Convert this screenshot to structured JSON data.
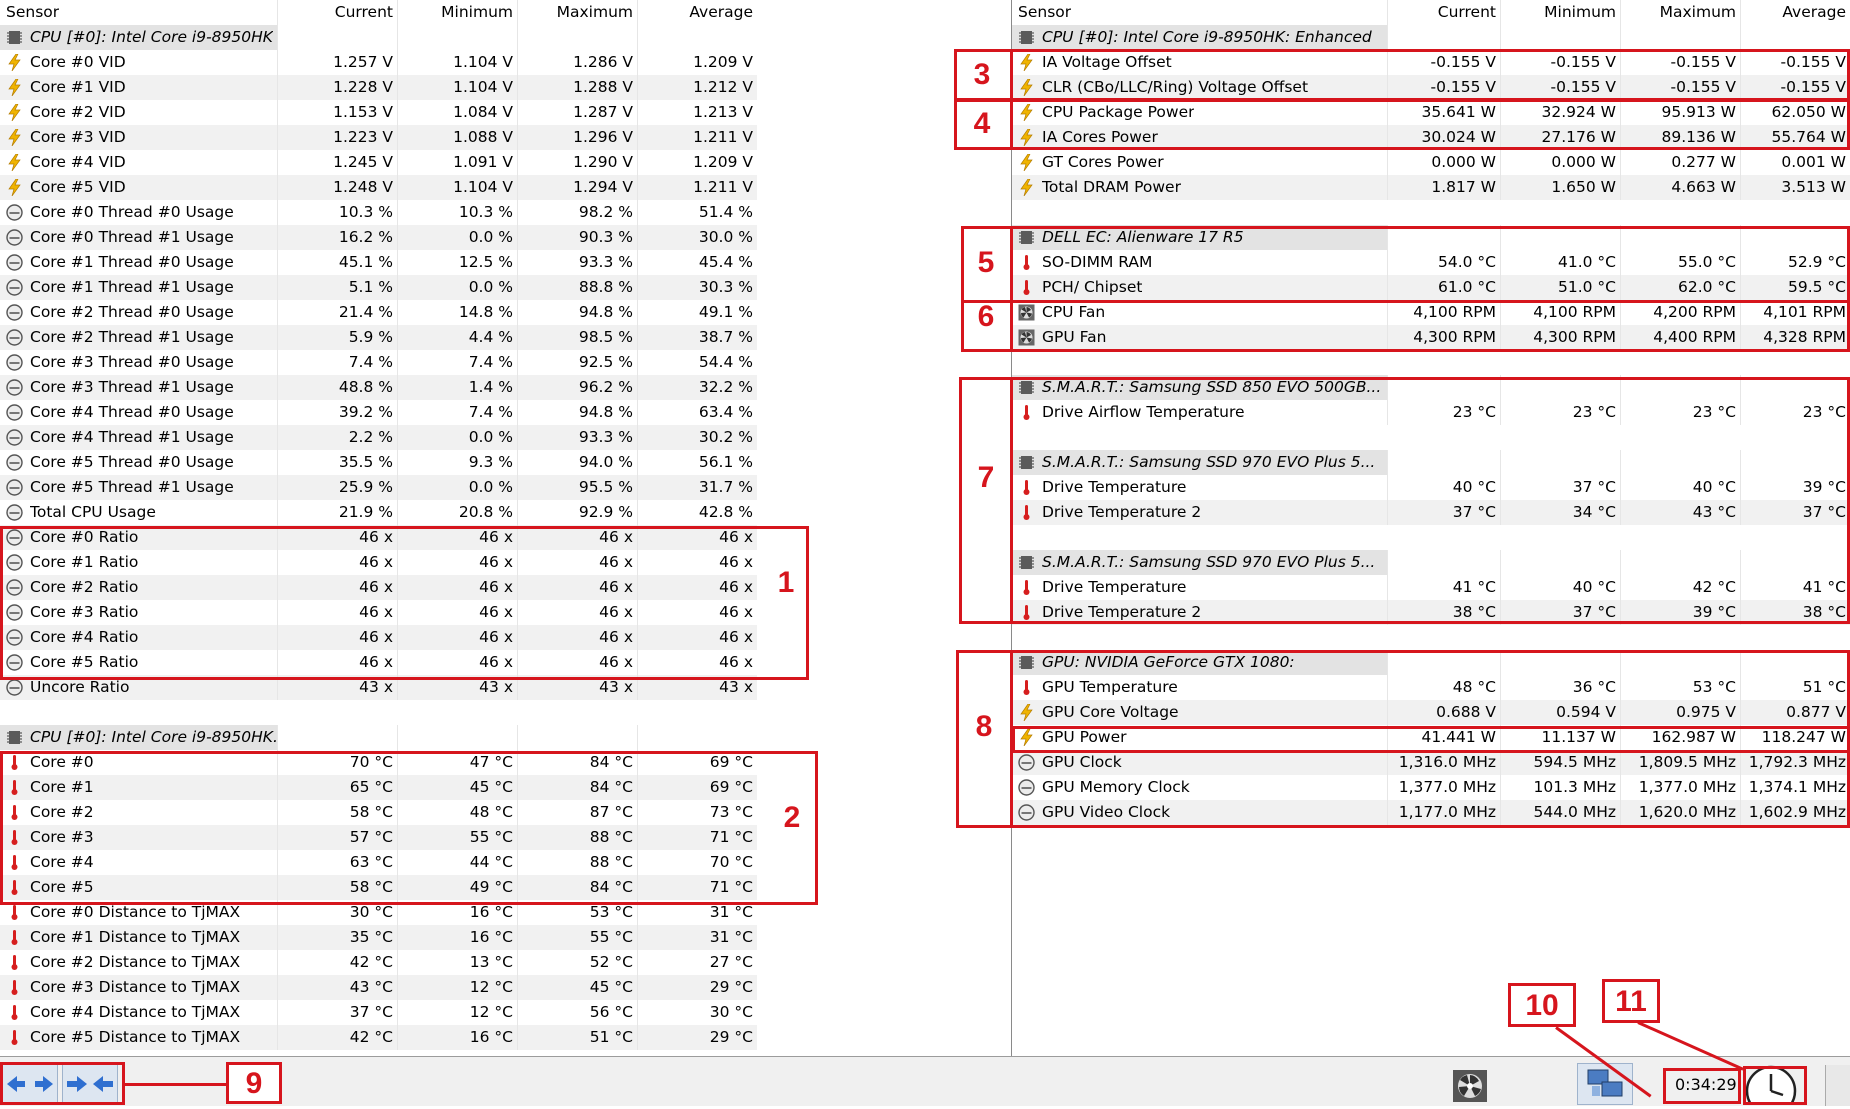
{
  "columns": [
    "Sensor",
    "Current",
    "Minimum",
    "Maximum",
    "Average"
  ],
  "left_rows": [
    {
      "kind": "group",
      "icon": "chip-icon",
      "name": "CPU [#0]: Intel Core i9-8950HK"
    },
    {
      "kind": "data",
      "icon": "voltage-icon",
      "name": "Core #0 VID",
      "v": [
        "1.257 V",
        "1.104 V",
        "1.286 V",
        "1.209 V"
      ]
    },
    {
      "kind": "data",
      "icon": "voltage-icon",
      "name": "Core #1 VID",
      "v": [
        "1.228 V",
        "1.104 V",
        "1.288 V",
        "1.212 V"
      ]
    },
    {
      "kind": "data",
      "icon": "voltage-icon",
      "name": "Core #2 VID",
      "v": [
        "1.153 V",
        "1.084 V",
        "1.287 V",
        "1.213 V"
      ]
    },
    {
      "kind": "data",
      "icon": "voltage-icon",
      "name": "Core #3 VID",
      "v": [
        "1.223 V",
        "1.088 V",
        "1.296 V",
        "1.211 V"
      ]
    },
    {
      "kind": "data",
      "icon": "voltage-icon",
      "name": "Core #4 VID",
      "v": [
        "1.245 V",
        "1.091 V",
        "1.290 V",
        "1.209 V"
      ]
    },
    {
      "kind": "data",
      "icon": "voltage-icon",
      "name": "Core #5 VID",
      "v": [
        "1.248 V",
        "1.104 V",
        "1.294 V",
        "1.211 V"
      ]
    },
    {
      "kind": "data",
      "icon": "gauge-icon",
      "name": "Core #0 Thread #0 Usage",
      "v": [
        "10.3 %",
        "10.3 %",
        "98.2 %",
        "51.4 %"
      ]
    },
    {
      "kind": "data",
      "icon": "gauge-icon",
      "name": "Core #0 Thread #1 Usage",
      "v": [
        "16.2 %",
        "0.0 %",
        "90.3 %",
        "30.0 %"
      ]
    },
    {
      "kind": "data",
      "icon": "gauge-icon",
      "name": "Core #1 Thread #0 Usage",
      "v": [
        "45.1 %",
        "12.5 %",
        "93.3 %",
        "45.4 %"
      ]
    },
    {
      "kind": "data",
      "icon": "gauge-icon",
      "name": "Core #1 Thread #1 Usage",
      "v": [
        "5.1 %",
        "0.0 %",
        "88.8 %",
        "30.3 %"
      ]
    },
    {
      "kind": "data",
      "icon": "gauge-icon",
      "name": "Core #2 Thread #0 Usage",
      "v": [
        "21.4 %",
        "14.8 %",
        "94.8 %",
        "49.1 %"
      ]
    },
    {
      "kind": "data",
      "icon": "gauge-icon",
      "name": "Core #2 Thread #1 Usage",
      "v": [
        "5.9 %",
        "4.4 %",
        "98.5 %",
        "38.7 %"
      ]
    },
    {
      "kind": "data",
      "icon": "gauge-icon",
      "name": "Core #3 Thread #0 Usage",
      "v": [
        "7.4 %",
        "7.4 %",
        "92.5 %",
        "54.4 %"
      ]
    },
    {
      "kind": "data",
      "icon": "gauge-icon",
      "name": "Core #3 Thread #1 Usage",
      "v": [
        "48.8 %",
        "1.4 %",
        "96.2 %",
        "32.2 %"
      ]
    },
    {
      "kind": "data",
      "icon": "gauge-icon",
      "name": "Core #4 Thread #0 Usage",
      "v": [
        "39.2 %",
        "7.4 %",
        "94.8 %",
        "63.4 %"
      ]
    },
    {
      "kind": "data",
      "icon": "gauge-icon",
      "name": "Core #4 Thread #1 Usage",
      "v": [
        "2.2 %",
        "0.0 %",
        "93.3 %",
        "30.2 %"
      ]
    },
    {
      "kind": "data",
      "icon": "gauge-icon",
      "name": "Core #5 Thread #0 Usage",
      "v": [
        "35.5 %",
        "9.3 %",
        "94.0 %",
        "56.1 %"
      ]
    },
    {
      "kind": "data",
      "icon": "gauge-icon",
      "name": "Core #5 Thread #1 Usage",
      "v": [
        "25.9 %",
        "0.0 %",
        "95.5 %",
        "31.7 %"
      ]
    },
    {
      "kind": "data",
      "icon": "gauge-icon",
      "name": "Total CPU Usage",
      "v": [
        "21.9 %",
        "20.8 %",
        "92.9 %",
        "42.8 %"
      ]
    },
    {
      "kind": "data",
      "icon": "gauge-icon",
      "name": "Core #0 Ratio",
      "v": [
        "46 x",
        "46 x",
        "46 x",
        "46 x"
      ]
    },
    {
      "kind": "data",
      "icon": "gauge-icon",
      "name": "Core #1 Ratio",
      "v": [
        "46 x",
        "46 x",
        "46 x",
        "46 x"
      ]
    },
    {
      "kind": "data",
      "icon": "gauge-icon",
      "name": "Core #2 Ratio",
      "v": [
        "46 x",
        "46 x",
        "46 x",
        "46 x"
      ]
    },
    {
      "kind": "data",
      "icon": "gauge-icon",
      "name": "Core #3 Ratio",
      "v": [
        "46 x",
        "46 x",
        "46 x",
        "46 x"
      ]
    },
    {
      "kind": "data",
      "icon": "gauge-icon",
      "name": "Core #4 Ratio",
      "v": [
        "46 x",
        "46 x",
        "46 x",
        "46 x"
      ]
    },
    {
      "kind": "data",
      "icon": "gauge-icon",
      "name": "Core #5 Ratio",
      "v": [
        "46 x",
        "46 x",
        "46 x",
        "46 x"
      ]
    },
    {
      "kind": "data",
      "icon": "gauge-icon",
      "name": "Uncore Ratio",
      "v": [
        "43 x",
        "43 x",
        "43 x",
        "43 x"
      ]
    },
    {
      "kind": "blank"
    },
    {
      "kind": "group",
      "icon": "chip-icon",
      "name": "CPU [#0]: Intel Core i9-8950HK..."
    },
    {
      "kind": "data",
      "icon": "thermometer-icon",
      "name": "Core #0",
      "v": [
        "70 °C",
        "47 °C",
        "84 °C",
        "69 °C"
      ]
    },
    {
      "kind": "data",
      "icon": "thermometer-icon",
      "name": "Core #1",
      "v": [
        "65 °C",
        "45 °C",
        "84 °C",
        "69 °C"
      ]
    },
    {
      "kind": "data",
      "icon": "thermometer-icon",
      "name": "Core #2",
      "v": [
        "58 °C",
        "48 °C",
        "87 °C",
        "73 °C"
      ]
    },
    {
      "kind": "data",
      "icon": "thermometer-icon",
      "name": "Core #3",
      "v": [
        "57 °C",
        "55 °C",
        "88 °C",
        "71 °C"
      ]
    },
    {
      "kind": "data",
      "icon": "thermometer-icon",
      "name": "Core #4",
      "v": [
        "63 °C",
        "44 °C",
        "88 °C",
        "70 °C"
      ]
    },
    {
      "kind": "data",
      "icon": "thermometer-icon",
      "name": "Core #5",
      "v": [
        "58 °C",
        "49 °C",
        "84 °C",
        "71 °C"
      ]
    },
    {
      "kind": "data",
      "icon": "thermometer-icon",
      "name": "Core #0 Distance to TjMAX",
      "v": [
        "30 °C",
        "16 °C",
        "53 °C",
        "31 °C"
      ]
    },
    {
      "kind": "data",
      "icon": "thermometer-icon",
      "name": "Core #1 Distance to TjMAX",
      "v": [
        "35 °C",
        "16 °C",
        "55 °C",
        "31 °C"
      ]
    },
    {
      "kind": "data",
      "icon": "thermometer-icon",
      "name": "Core #2 Distance to TjMAX",
      "v": [
        "42 °C",
        "13 °C",
        "52 °C",
        "27 °C"
      ]
    },
    {
      "kind": "data",
      "icon": "thermometer-icon",
      "name": "Core #3 Distance to TjMAX",
      "v": [
        "43 °C",
        "12 °C",
        "45 °C",
        "29 °C"
      ]
    },
    {
      "kind": "data",
      "icon": "thermometer-icon",
      "name": "Core #4 Distance to TjMAX",
      "v": [
        "37 °C",
        "12 °C",
        "56 °C",
        "30 °C"
      ]
    },
    {
      "kind": "data",
      "icon": "thermometer-icon",
      "name": "Core #5 Distance to TjMAX",
      "v": [
        "42 °C",
        "16 °C",
        "51 °C",
        "29 °C"
      ]
    }
  ],
  "right_rows": [
    {
      "kind": "group",
      "icon": "chip-icon",
      "name": "CPU [#0]: Intel Core i9-8950HK: Enhanced"
    },
    {
      "kind": "data",
      "icon": "voltage-icon",
      "name": "IA Voltage Offset",
      "v": [
        "-0.155 V",
        "-0.155 V",
        "-0.155 V",
        "-0.155 V"
      ]
    },
    {
      "kind": "data",
      "icon": "voltage-icon",
      "name": "CLR (CBo/LLC/Ring) Voltage Offset",
      "v": [
        "-0.155 V",
        "-0.155 V",
        "-0.155 V",
        "-0.155 V"
      ]
    },
    {
      "kind": "data",
      "icon": "power-icon",
      "name": "CPU Package Power",
      "v": [
        "35.641 W",
        "32.924 W",
        "95.913 W",
        "62.050 W"
      ]
    },
    {
      "kind": "data",
      "icon": "power-icon",
      "name": "IA Cores Power",
      "v": [
        "30.024 W",
        "27.176 W",
        "89.136 W",
        "55.764 W"
      ]
    },
    {
      "kind": "data",
      "icon": "power-icon",
      "name": "GT Cores Power",
      "v": [
        "0.000 W",
        "0.000 W",
        "0.277 W",
        "0.001 W"
      ]
    },
    {
      "kind": "data",
      "icon": "power-icon",
      "name": "Total DRAM Power",
      "v": [
        "1.817 W",
        "1.650 W",
        "4.663 W",
        "3.513 W"
      ]
    },
    {
      "kind": "blank"
    },
    {
      "kind": "group",
      "icon": "chip-icon",
      "name": "DELL EC: Alienware 17 R5"
    },
    {
      "kind": "data",
      "icon": "thermometer-icon",
      "name": "SO-DIMM RAM",
      "v": [
        "54.0 °C",
        "41.0 °C",
        "55.0 °C",
        "52.9 °C"
      ]
    },
    {
      "kind": "data",
      "icon": "thermometer-icon",
      "name": "PCH/ Chipset",
      "v": [
        "61.0 °C",
        "51.0 °C",
        "62.0 °C",
        "59.5 °C"
      ]
    },
    {
      "kind": "data",
      "icon": "fan-icon",
      "name": "CPU Fan",
      "v": [
        "4,100 RPM",
        "4,100 RPM",
        "4,200 RPM",
        "4,101 RPM"
      ]
    },
    {
      "kind": "data",
      "icon": "fan-icon",
      "name": "GPU Fan",
      "v": [
        "4,300 RPM",
        "4,300 RPM",
        "4,400 RPM",
        "4,328 RPM"
      ]
    },
    {
      "kind": "blank"
    },
    {
      "kind": "group",
      "icon": "chip-icon",
      "name": "S.M.A.R.T.: Samsung SSD 850 EVO 500GB..."
    },
    {
      "kind": "data",
      "icon": "thermometer-icon",
      "name": "Drive Airflow Temperature",
      "v": [
        "23 °C",
        "23 °C",
        "23 °C",
        "23 °C"
      ]
    },
    {
      "kind": "blank"
    },
    {
      "kind": "group",
      "icon": "chip-icon",
      "name": "S.M.A.R.T.: Samsung SSD 970 EVO Plus 5..."
    },
    {
      "kind": "data",
      "icon": "thermometer-icon",
      "name": "Drive Temperature",
      "v": [
        "40 °C",
        "37 °C",
        "40 °C",
        "39 °C"
      ]
    },
    {
      "kind": "data",
      "icon": "thermometer-icon",
      "name": "Drive Temperature 2",
      "v": [
        "37 °C",
        "34 °C",
        "43 °C",
        "37 °C"
      ]
    },
    {
      "kind": "blank"
    },
    {
      "kind": "group",
      "icon": "chip-icon",
      "name": "S.M.A.R.T.: Samsung SSD 970 EVO Plus 5..."
    },
    {
      "kind": "data",
      "icon": "thermometer-icon",
      "name": "Drive Temperature",
      "v": [
        "41 °C",
        "40 °C",
        "42 °C",
        "41 °C"
      ]
    },
    {
      "kind": "data",
      "icon": "thermometer-icon",
      "name": "Drive Temperature 2",
      "v": [
        "38 °C",
        "37 °C",
        "39 °C",
        "38 °C"
      ]
    },
    {
      "kind": "blank"
    },
    {
      "kind": "group",
      "icon": "chip-icon",
      "name": "GPU: NVIDIA GeForce GTX 1080:"
    },
    {
      "kind": "data",
      "icon": "thermometer-icon",
      "name": "GPU Temperature",
      "v": [
        "48 °C",
        "36 °C",
        "53 °C",
        "51 °C"
      ]
    },
    {
      "kind": "data",
      "icon": "voltage-icon",
      "name": "GPU Core Voltage",
      "v": [
        "0.688 V",
        "0.594 V",
        "0.975 V",
        "0.877 V"
      ]
    },
    {
      "kind": "data",
      "icon": "power-icon",
      "name": "GPU Power",
      "v": [
        "41.441 W",
        "11.137 W",
        "162.987 W",
        "118.247 W"
      ]
    },
    {
      "kind": "data",
      "icon": "gauge-icon",
      "name": "GPU Clock",
      "v": [
        "1,316.0 MHz",
        "594.5 MHz",
        "1,809.5 MHz",
        "1,792.3 MHz"
      ]
    },
    {
      "kind": "data",
      "icon": "gauge-icon",
      "name": "GPU Memory Clock",
      "v": [
        "1,377.0 MHz",
        "101.3 MHz",
        "1,377.0 MHz",
        "1,374.1 MHz"
      ]
    },
    {
      "kind": "data",
      "icon": "gauge-icon",
      "name": "GPU Video Clock",
      "v": [
        "1,177.0 MHz",
        "544.0 MHz",
        "1,620.0 MHz",
        "1,602.9 MHz"
      ]
    }
  ],
  "annotations": [
    "1",
    "2",
    "3",
    "4",
    "5",
    "6",
    "7",
    "8",
    "9",
    "10",
    "11"
  ],
  "statusbar": {
    "timer": "0:34:29",
    "icons": [
      "expand-icon",
      "collapse-icon",
      "fan-settings-icon",
      "network-icon",
      "clock-icon"
    ]
  },
  "colors": {
    "annotation": "#d6151d",
    "group_bg": "#e3e3e3",
    "alt_row": "#f1f1f1"
  }
}
